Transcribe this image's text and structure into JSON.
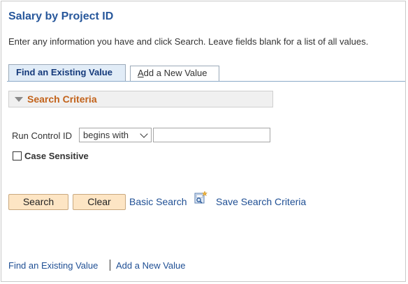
{
  "page": {
    "title": "Salary by Project ID",
    "instructions": "Enter any information you have and click Search. Leave fields blank for a list of all values."
  },
  "tabs": {
    "find_label": "Find an Existing Value",
    "add_accesskey": "A",
    "add_rest": "dd a New Value"
  },
  "criteria": {
    "section_label": "Search Criteria",
    "run_control_label": "Run Control ID",
    "operator_value": "begins with",
    "run_control_value": "",
    "case_sensitive_label": "Case Sensitive",
    "case_sensitive_checked": false
  },
  "actions": {
    "search_label": "Search",
    "clear_label": "Clear",
    "basic_search_label": "Basic Search",
    "save_criteria_label": "Save Search Criteria",
    "save_icon": "save-search-icon"
  },
  "footer": {
    "find_label": "Find an Existing Value",
    "add_label": "Add a New Value"
  },
  "colors": {
    "title": "#27579b",
    "link": "#1f4f94",
    "section_label": "#c2621a",
    "button_bg": "#fde5c4",
    "active_tab_bg": "#e1ecf7"
  }
}
